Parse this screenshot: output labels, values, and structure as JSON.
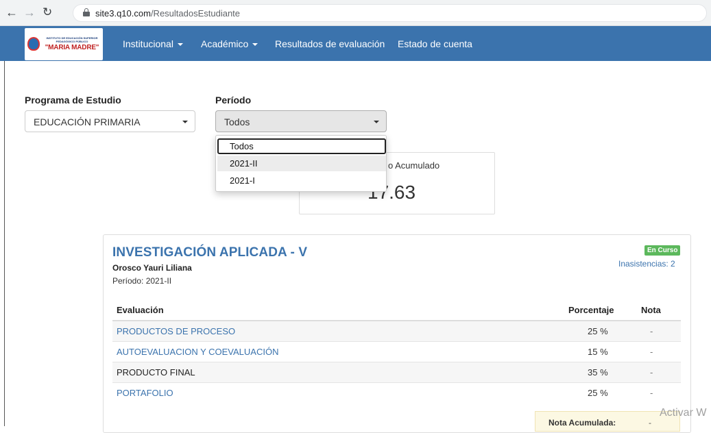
{
  "browser": {
    "back_icon": "arrow-left-icon",
    "forward_icon": "arrow-right-icon",
    "reload_icon": "reload-icon",
    "url_host": "site3.q10.com",
    "url_path": "/ResultadosEstudiante"
  },
  "nav": {
    "logo_line1": "INSTITUTO DE EDUCACIÓN SUPERIOR PEDAGÓGICO PÚBLICO",
    "logo_line2": "\"MARIA MADRE\"",
    "items": [
      {
        "label": "Institucional",
        "has_caret": true
      },
      {
        "label": "Académico",
        "has_caret": true
      },
      {
        "label": "Resultados de evaluación",
        "has_caret": false
      },
      {
        "label": "Estado de cuenta",
        "has_caret": false
      }
    ],
    "color": "#3b73ad"
  },
  "filters": {
    "program_label": "Programa de Estudio",
    "program_value": "EDUCACIÓN PRIMARIA",
    "period_label": "Período",
    "period_value": "Todos",
    "period_options": [
      "Todos",
      "2021-II",
      "2021-I"
    ]
  },
  "summary": {
    "label": "o Acumulado",
    "value": "17.63"
  },
  "course": {
    "title": "INVESTIGACIÓN APLICADA - V",
    "student": "Orosco Yauri Liliana",
    "period": "Período: 2021-II",
    "status_badge": "En Curso",
    "absences": "Inasistencias: 2",
    "table": {
      "headers": {
        "evaluation": "Evaluación",
        "percentage": "Porcentaje",
        "grade": "Nota"
      },
      "rows": [
        {
          "name": "PRODUCTOS DE PROCESO",
          "percent": "25 %",
          "grade": "-",
          "is_link": true
        },
        {
          "name": "AUTOEVALUACION Y COEVALUACIÓN",
          "percent": "15 %",
          "grade": "-",
          "is_link": true
        },
        {
          "name": "PRODUCTO FINAL",
          "percent": "35 %",
          "grade": "-",
          "is_link": false
        },
        {
          "name": "PORTAFOLIO",
          "percent": "25 %",
          "grade": "-",
          "is_link": true
        }
      ]
    },
    "accumulated_label": "Nota Acumulada:",
    "accumulated_value": "-"
  },
  "watermark": "Activar W",
  "colors": {
    "link": "#3b73ad",
    "badge": "#5cb85c",
    "nota_bg": "#fcf8e3"
  }
}
